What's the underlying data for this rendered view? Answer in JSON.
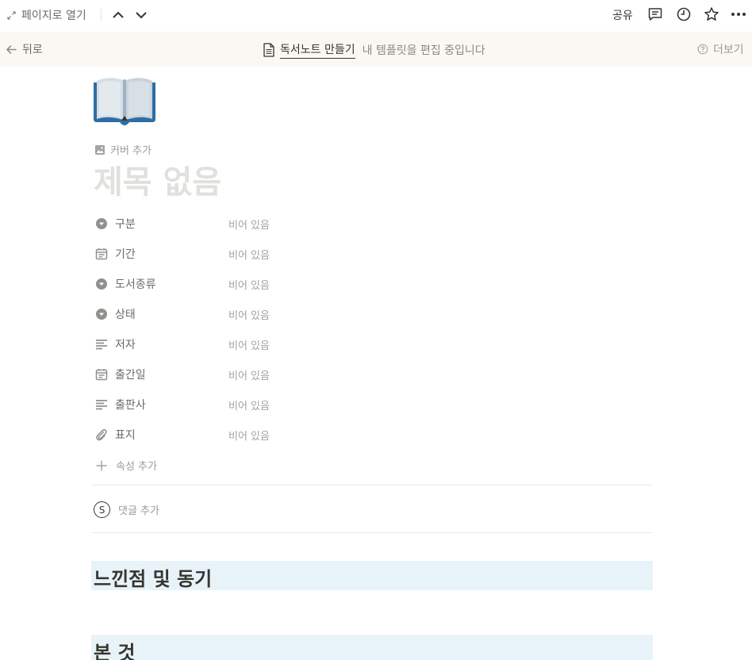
{
  "topbar": {
    "open_as_page": "페이지로 열기",
    "share": "공유",
    "icons": [
      "expand-arrows-icon",
      "chevron-up-icon",
      "chevron-down-icon",
      "comment-icon",
      "clock-icon",
      "star-icon",
      "more-icon"
    ]
  },
  "banner": {
    "back": "뒤로",
    "template_name": "독서노트 만들기",
    "editing_note": "내 템플릿을 편집 중입니다",
    "more": "더보기"
  },
  "page": {
    "icon": "open-book-icon",
    "add_cover": "커버 추가",
    "title_placeholder": "제목 없음",
    "properties": [
      {
        "name": "구분",
        "type": "select",
        "value": "비어 있음"
      },
      {
        "name": "기간",
        "type": "date",
        "value": "비어 있음"
      },
      {
        "name": "도서종류",
        "type": "select",
        "value": "비어 있음"
      },
      {
        "name": "상태",
        "type": "select",
        "value": "비어 있음"
      },
      {
        "name": "저자",
        "type": "text",
        "value": "비어 있음"
      },
      {
        "name": "출간일",
        "type": "date",
        "value": "비어 있음"
      },
      {
        "name": "출판사",
        "type": "text",
        "value": "비어 있음"
      },
      {
        "name": "표지",
        "type": "files",
        "value": "비어 있음"
      }
    ],
    "add_property": "속성 추가",
    "comment_avatar": "S",
    "add_comment": "댓글 추가",
    "headings": [
      "느낀점 및 동기",
      "본 것"
    ],
    "heading_bg": "#e7f3f8"
  }
}
